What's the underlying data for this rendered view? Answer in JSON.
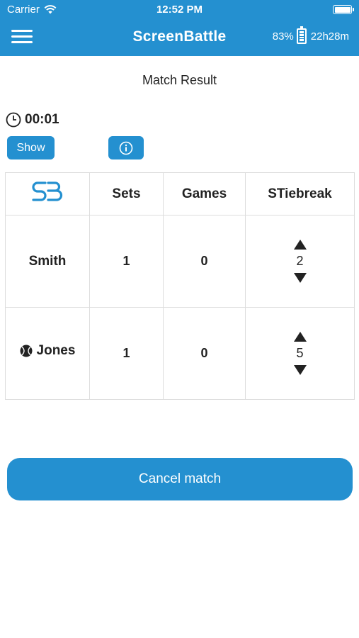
{
  "status_bar": {
    "carrier": "Carrier",
    "time": "12:52 PM"
  },
  "header": {
    "title": "ScreenBattle",
    "battery_percent": "83%",
    "battery_time": "22h28m"
  },
  "page": {
    "title": "Match Result"
  },
  "timer": {
    "value": "00:01"
  },
  "buttons": {
    "show_label": "Show",
    "cancel_label": "Cancel match"
  },
  "table": {
    "logo": "SB",
    "columns": [
      "Sets",
      "Games",
      "STiebreak"
    ],
    "rows": [
      {
        "name": "Smith",
        "serving": false,
        "sets": "1",
        "games": "0",
        "tiebreak": "2"
      },
      {
        "name": "Jones",
        "serving": true,
        "sets": "1",
        "games": "0",
        "tiebreak": "5"
      }
    ]
  },
  "colors": {
    "accent": "#2490d0",
    "grid": "#dddddd",
    "text": "#222222"
  },
  "icons": [
    "wifi-icon",
    "battery-icon",
    "menu-icon",
    "phone-battery-icon",
    "clock-icon",
    "info-icon",
    "sb-logo",
    "tennis-ball-icon",
    "arrow-up-icon",
    "arrow-down-icon"
  ]
}
